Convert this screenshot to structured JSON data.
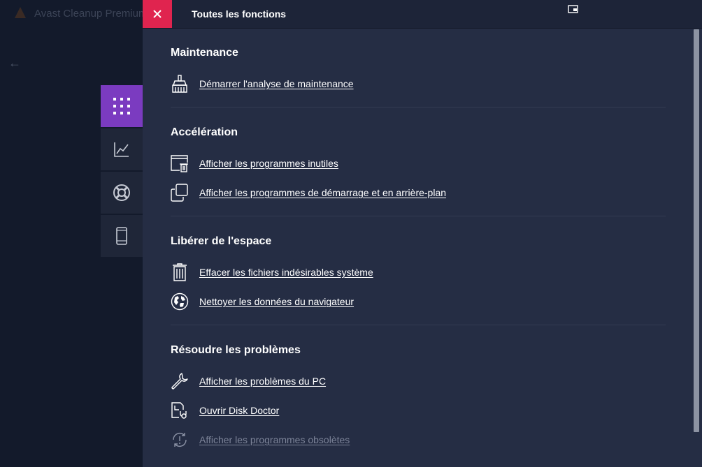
{
  "background": {
    "app_title": "Avast Cleanup Premium",
    "back_icon": "arrow-left-icon",
    "rail": [
      {
        "icon": "grid-icon",
        "active": true
      },
      {
        "icon": "chart-line-icon",
        "active": false
      },
      {
        "icon": "lifebuoy-icon",
        "active": false
      },
      {
        "icon": "mobile-phone-icon",
        "active": false
      }
    ]
  },
  "panel": {
    "title": "Toutes les fonctions",
    "close_icon": "close-icon",
    "header_icon": "window-icon",
    "sections": [
      {
        "title": "Maintenance",
        "items": [
          {
            "label": "Démarrer l'analyse de maintenance",
            "icon": "broom-icon"
          }
        ]
      },
      {
        "title": "Accélération",
        "items": [
          {
            "label": "Afficher les programmes inutiles",
            "icon": "window-trash-icon"
          },
          {
            "label": "Afficher les programmes de démarrage et en arrière-plan",
            "icon": "copy-windows-icon"
          }
        ]
      },
      {
        "title": "Libérer de l'espace",
        "items": [
          {
            "label": "Effacer les fichiers indésirables système",
            "icon": "trash-icon"
          },
          {
            "label": "Nettoyer les données du navigateur",
            "icon": "globe-icon"
          }
        ]
      },
      {
        "title": "Résoudre les problèmes",
        "items": [
          {
            "label": "Afficher les problèmes du PC",
            "icon": "wrench-icon"
          },
          {
            "label": "Ouvrir Disk Doctor",
            "icon": "disk-doctor-icon"
          },
          {
            "label": "Afficher les programmes obsolètes",
            "icon": "update-alert-icon"
          }
        ]
      }
    ]
  },
  "colors": {
    "accent_close": "#e0244f",
    "accent_rail_active": "#7b3bc0",
    "panel_bg": "#252d44"
  }
}
